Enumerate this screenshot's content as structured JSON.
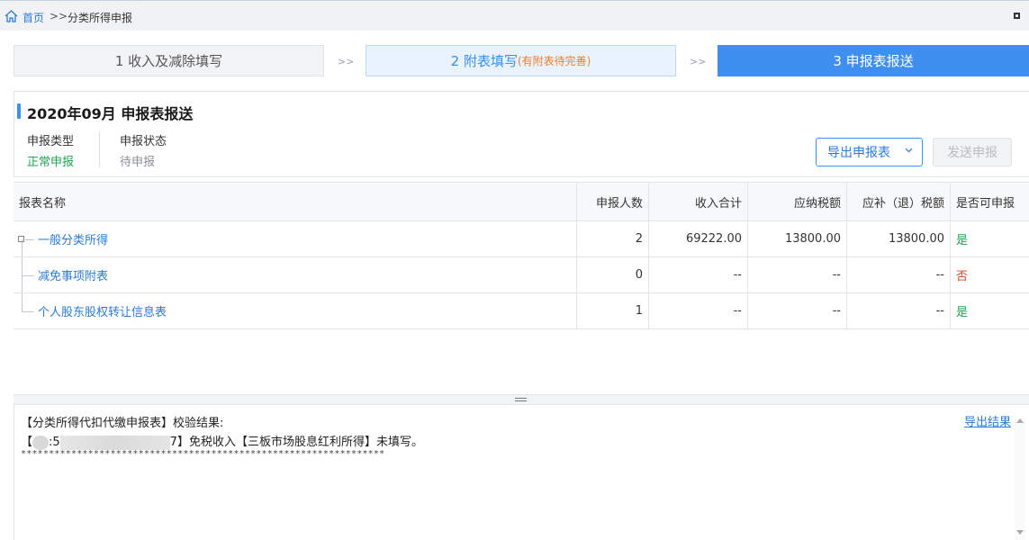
{
  "breadcrumb": {
    "home": "首页",
    "separator": ">>",
    "current": "分类所得申报"
  },
  "steps": [
    {
      "label": "1 收入及减除填写"
    },
    {
      "label": "2 附表填写",
      "note": "(有附表待完善)"
    },
    {
      "label": "3 申报表报送"
    }
  ],
  "step_arrow": ">>",
  "panel": {
    "title": "2020年09月  申报表报送",
    "report_type_label": "申报类型",
    "report_type_value": "正常申报",
    "report_status_label": "申报状态",
    "report_status_value": "待申报",
    "export_button": "导出申报表",
    "send_button": "发送申报"
  },
  "table": {
    "headers": [
      "报表名称",
      "申报人数",
      "收入合计",
      "应纳税额",
      "应补（退）税额",
      "是否可申报"
    ],
    "rows": [
      {
        "name": "一般分类所得",
        "count": "2",
        "income": "69222.00",
        "tax": "13800.00",
        "due": "13800.00",
        "ok": "是"
      },
      {
        "name": "减免事项附表",
        "count": "0",
        "income": "--",
        "tax": "--",
        "due": "--",
        "ok": "否"
      },
      {
        "name": "个人股东股权转让信息表",
        "count": "1",
        "income": "--",
        "tax": "--",
        "due": "--",
        "ok": "是"
      }
    ]
  },
  "result": {
    "line1": "【分类所得代扣代缴申报表】校验结果:",
    "line2_prefix": "【",
    "line2_mid": ":5",
    "line2_suffix": "7】免税收入【三板市场股息红利所得】未填写。",
    "stars": "*****************************************************************",
    "export_link": "导出结果"
  },
  "colors": {
    "accent": "#3e8ff0",
    "link": "#2b7bd6",
    "yes": "#22a153",
    "no": "#e2452b",
    "warning": "#ef7d2a"
  }
}
